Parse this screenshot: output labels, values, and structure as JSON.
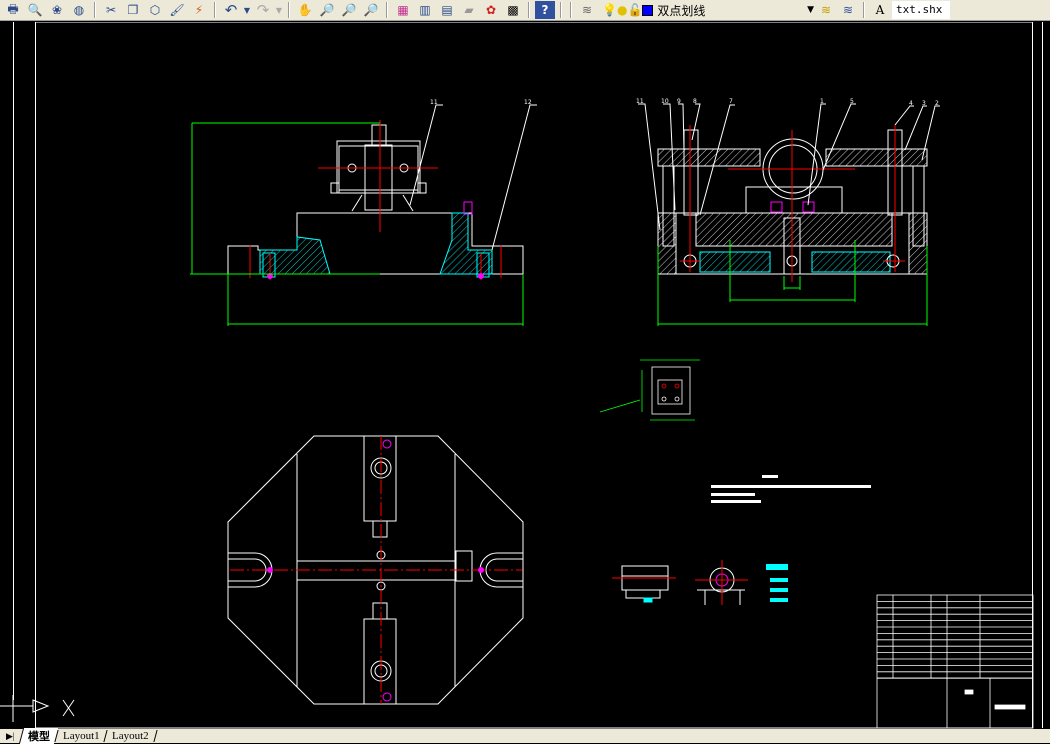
{
  "toolbar": {
    "icons": [
      "plot-icon",
      "plot-preview-icon",
      "publish-icon",
      "publish-web-icon",
      "cut-icon",
      "copy-icon",
      "paste-icon",
      "match-properties-icon",
      "block-editor-icon",
      "undo-icon",
      "redo-icon",
      "pan-icon",
      "zoom-realtime-icon",
      "zoom-window-icon",
      "zoom-previous-icon",
      "properties-icon",
      "design-center-icon",
      "tool-palettes-icon",
      "sheet-set-icon",
      "markup-icon",
      "calculator-icon",
      "help-icon"
    ],
    "layer_manager_icon": "layer-properties-icon",
    "layer": {
      "name": "双点划线",
      "color": "#0000ff",
      "state_icons": [
        "lightbulb-icon",
        "sun-icon",
        "lock-icon"
      ]
    },
    "text_style": "txt.shx"
  },
  "drawing": {
    "colors": {
      "outline": "#ffffff",
      "center": "#ff0000",
      "dimension": "#00ff00",
      "hatch": "#00ffff",
      "highlight": "#ff00ff",
      "background": "#000000"
    },
    "front_view_balloons": [
      "11",
      "12"
    ],
    "side_view_balloons": [
      "11",
      "10",
      "9",
      "8",
      "7",
      "1",
      "5",
      "4",
      "3",
      "2"
    ]
  },
  "tabs": [
    {
      "label": "模型",
      "active": true
    },
    {
      "label": "Layout1",
      "active": false
    },
    {
      "label": "Layout2",
      "active": false
    }
  ]
}
